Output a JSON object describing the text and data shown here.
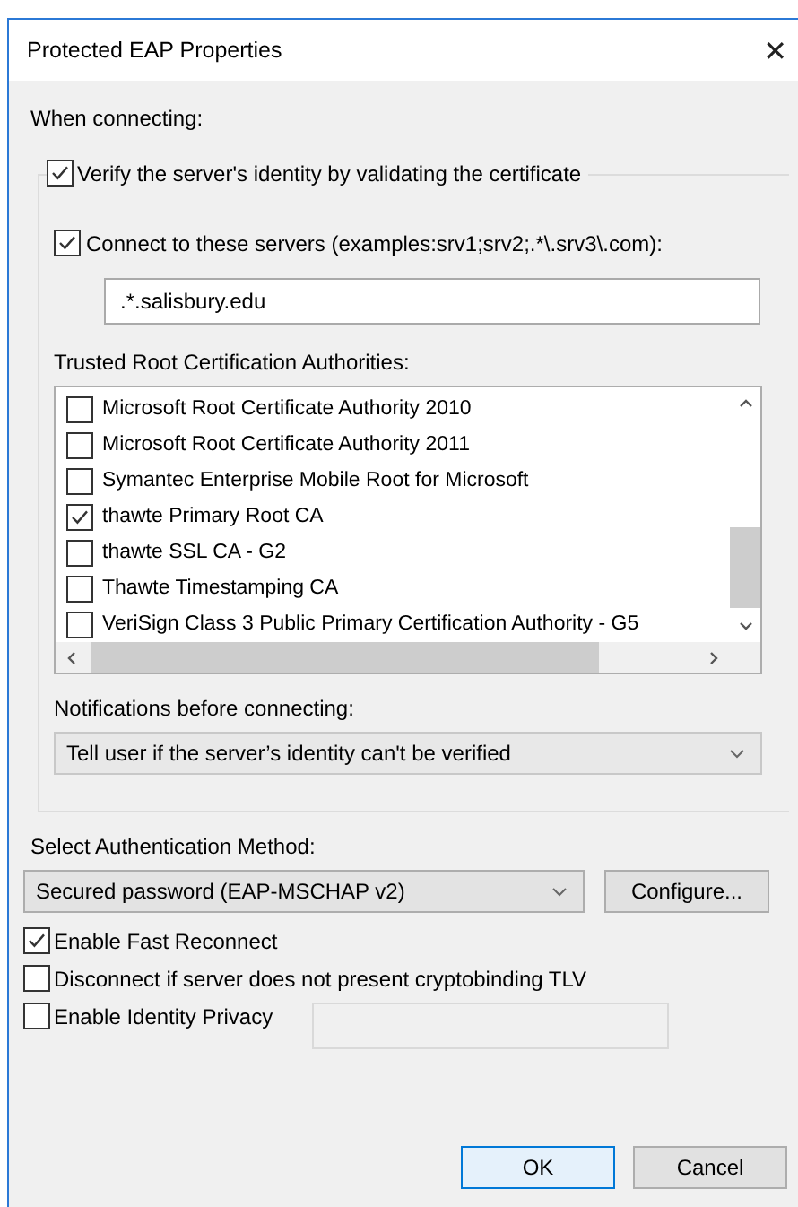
{
  "window": {
    "title": "Protected EAP Properties",
    "close": "✕"
  },
  "when_connecting": "When connecting:",
  "verify": {
    "label": "Verify the server's identity by validating the certificate",
    "checked": true
  },
  "connect": {
    "label": "Connect to these servers (examples:srv1;srv2;.*\\.srv3\\.com):",
    "checked": true
  },
  "servers_field": {
    "value": ".*.salisbury.edu"
  },
  "trusted_label": "Trusted Root Certification Authorities:",
  "certificates": [
    {
      "name": "Microsoft Root Certificate Authority 2010",
      "checked": false
    },
    {
      "name": "Microsoft Root Certificate Authority 2011",
      "checked": false
    },
    {
      "name": "Symantec Enterprise Mobile Root for Microsoft",
      "checked": false
    },
    {
      "name": "thawte Primary Root CA",
      "checked": true
    },
    {
      "name": "thawte SSL CA - G2",
      "checked": false
    },
    {
      "name": "Thawte Timestamping CA",
      "checked": false
    },
    {
      "name": "VeriSign Class 3 Public Primary Certification Authority - G5",
      "checked": false
    }
  ],
  "notifications_label": "Notifications before connecting:",
  "notifications_dropdown": {
    "value": "Tell user if the server’s identity can't be verified"
  },
  "auth_label": "Select Authentication Method:",
  "auth_dropdown": {
    "value": "Secured password (EAP-MSCHAP v2)"
  },
  "configure_button": "Configure...",
  "options": [
    {
      "kind": "checkbox",
      "label": "Enable Fast Reconnect",
      "checked": true
    },
    {
      "kind": "checkbox",
      "label": "Disconnect if server does not present cryptobinding TLV",
      "checked": false
    },
    {
      "kind": "checkbox_field",
      "label": "Enable Identity Privacy",
      "checked": false
    }
  ],
  "buttons": [
    {
      "label": "OK",
      "default": true
    },
    {
      "label": "Cancel",
      "default": false
    }
  ]
}
